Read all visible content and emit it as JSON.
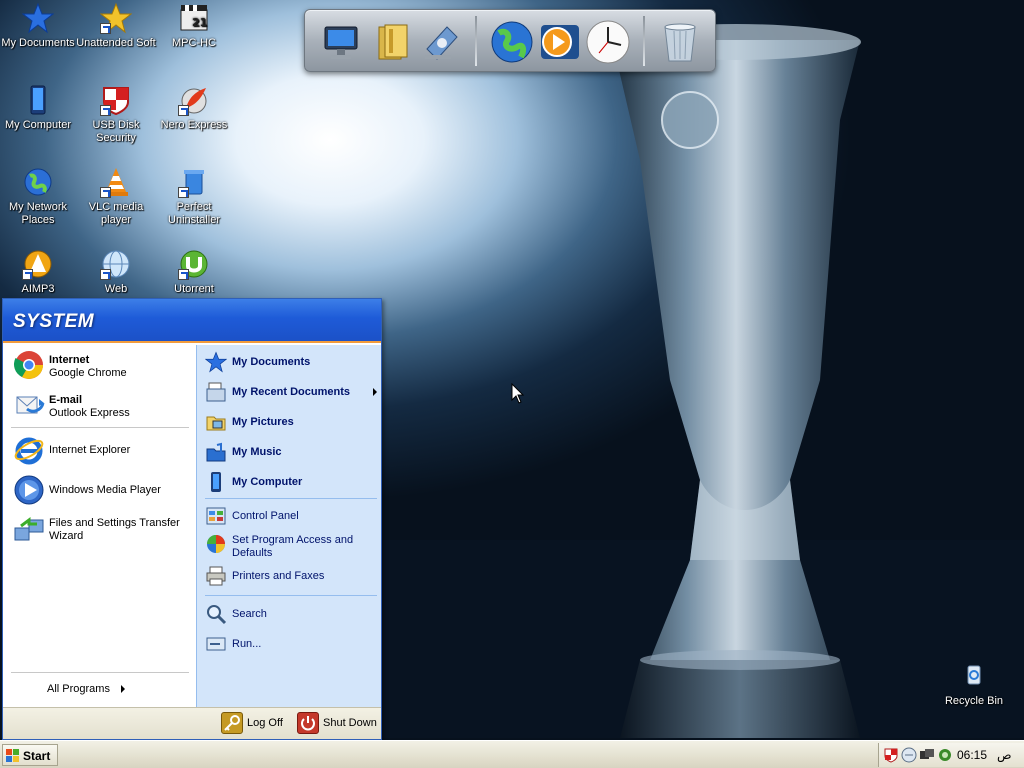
{
  "desktop": {
    "icons": [
      {
        "label": "My Documents"
      },
      {
        "label": "Unattended Soft"
      },
      {
        "label": "MPC-HC"
      },
      {
        "label": "My Computer"
      },
      {
        "label": "USB Disk Security"
      },
      {
        "label": "Nero Express"
      },
      {
        "label": "My Network Places"
      },
      {
        "label": "VLC media player"
      },
      {
        "label": "Perfect Uninstaller"
      },
      {
        "label": "AIMP3"
      },
      {
        "label": "Web"
      },
      {
        "label": "Utorrent"
      },
      {
        "label": "Recycle Bin"
      }
    ]
  },
  "dock": {
    "items": [
      "computer-icon",
      "folder-icon",
      "control-panel-icon",
      "globe-icon",
      "media-player-icon",
      "clock-icon",
      "trash-icon"
    ]
  },
  "start_menu": {
    "user": "SYSTEM",
    "pinned": [
      {
        "title": "Internet",
        "subtitle": "Google Chrome"
      },
      {
        "title": "E-mail",
        "subtitle": "Outlook Express"
      }
    ],
    "recent": [
      {
        "label": "Internet Explorer"
      },
      {
        "label": "Windows Media Player"
      },
      {
        "label": "Files and Settings Transfer Wizard"
      }
    ],
    "all_programs": "All Programs",
    "right": {
      "places": [
        {
          "label": "My Documents"
        },
        {
          "label": "My Recent Documents"
        },
        {
          "label": "My Pictures"
        },
        {
          "label": "My Music"
        },
        {
          "label": "My Computer"
        }
      ],
      "system": [
        {
          "label": "Control Panel"
        },
        {
          "label": "Set Program Access and Defaults"
        },
        {
          "label": "Printers and Faxes"
        }
      ],
      "tools": [
        {
          "label": "Search"
        },
        {
          "label": "Run..."
        }
      ]
    },
    "footer": {
      "log_off": "Log Off",
      "shut_down": "Shut Down"
    }
  },
  "taskbar": {
    "start_label": "Start",
    "clock_time": "06:15",
    "clock_suffix": "ص"
  },
  "colors": {
    "start_menu_header": "#1e5bd8",
    "start_menu_right_panel": "#d3e5fa",
    "taskbar": "#e3e0cf",
    "accent_orange": "#f29c3c"
  }
}
